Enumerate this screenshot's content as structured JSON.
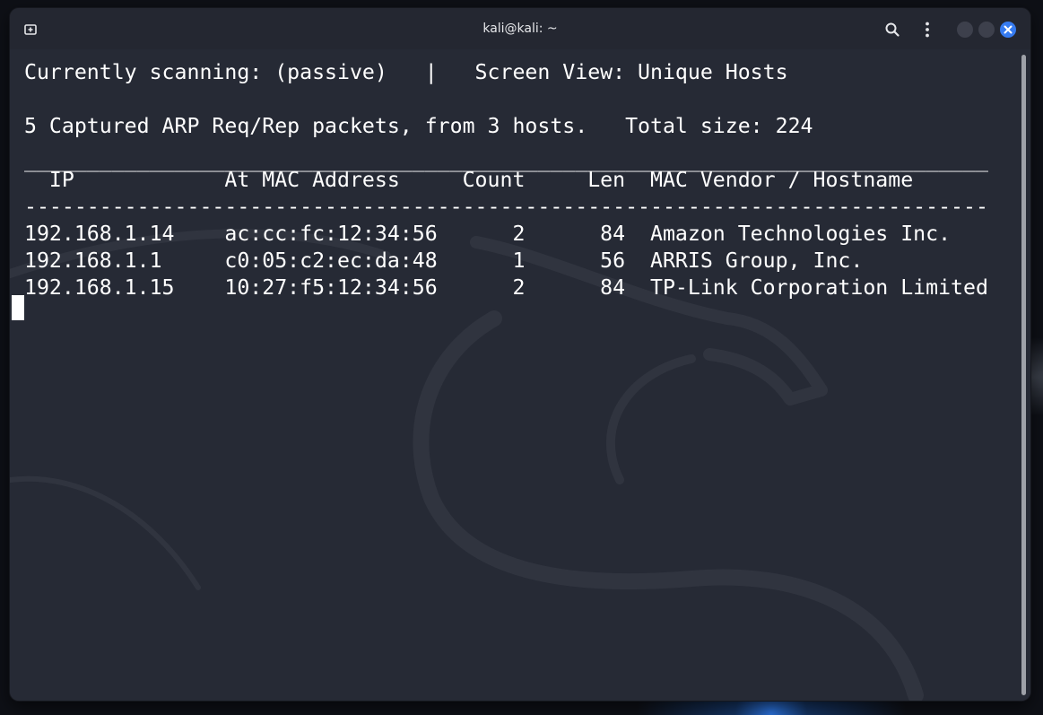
{
  "window": {
    "title": "kali@kali: ~",
    "icons": [
      "new-tab-icon",
      "search-icon",
      "kebab-menu-icon",
      "minimize-icon",
      "maximize-icon",
      "close-icon"
    ],
    "colors": {
      "close_accent": "#367bf0",
      "background": "#262a35",
      "text": "#ffffff"
    }
  },
  "terminal": {
    "status_line": "Currently scanning: (passive)   |   Screen View: Unique Hosts",
    "summary_line": "5 Captured ARP Req/Rep packets, from 3 hosts.   Total size: 224",
    "separator_top": "_____________________________________________________________________________",
    "header_line": "  IP            At MAC Address     Count     Len  MAC Vendor / Hostname",
    "separator_bottom": "-----------------------------------------------------------------------------",
    "columns": [
      "IP",
      "At MAC Address",
      "Count",
      "Len",
      "MAC Vendor / Hostname"
    ],
    "rows": [
      {
        "ip": "192.168.1.14",
        "mac": "ac:cc:fc:12:34:56",
        "count": "2",
        "len": "84",
        "vendor": "Amazon Technologies Inc.",
        "text": "192.168.1.14    ac:cc:fc:12:34:56      2      84  Amazon Technologies Inc."
      },
      {
        "ip": "192.168.1.1",
        "mac": "c0:05:c2:ec:da:48",
        "count": "1",
        "len": "56",
        "vendor": "ARRIS Group, Inc.",
        "text": "192.168.1.1     c0:05:c2:ec:da:48      1      56  ARRIS Group, Inc."
      },
      {
        "ip": "192.168.1.15",
        "mac": "10:27:f5:12:34:56",
        "count": "2",
        "len": "84",
        "vendor": "TP-Link Corporation Limited",
        "text": "192.168.1.15    10:27:f5:12:34:56      2      84  TP-Link Corporation Limited"
      }
    ]
  }
}
